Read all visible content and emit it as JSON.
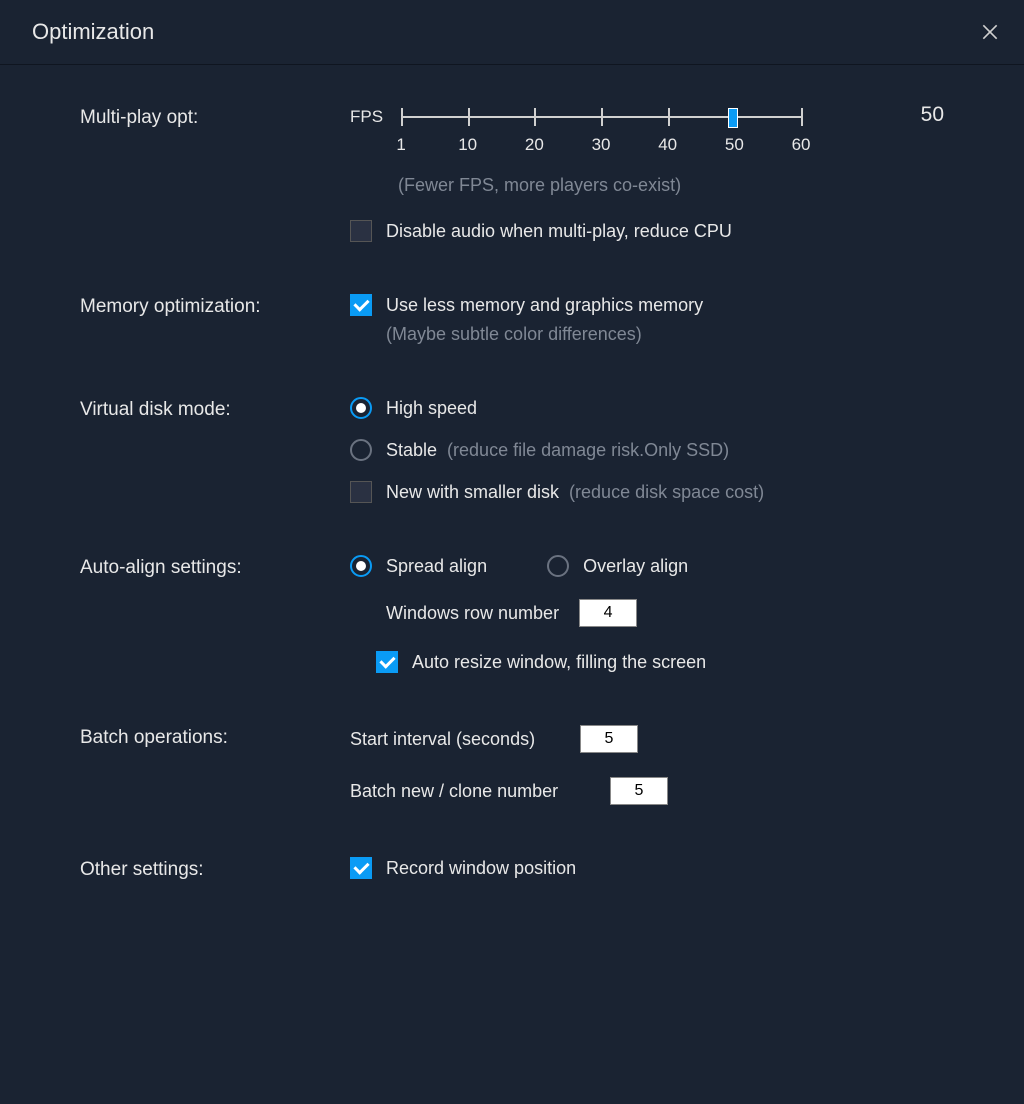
{
  "title": "Optimization",
  "multiPlay": {
    "label": "Multi-play opt:",
    "fpsLabel": "FPS",
    "min": 1,
    "max": 60,
    "value": 50,
    "ticks": [
      "1",
      "10",
      "20",
      "30",
      "40",
      "50",
      "60"
    ],
    "hint": "(Fewer FPS, more players co-exist)",
    "disableAudio": {
      "label": "Disable audio when multi-play, reduce CPU",
      "checked": false
    }
  },
  "memory": {
    "label": "Memory optimization:",
    "useLess": {
      "label": "Use less memory and graphics memory",
      "checked": true,
      "hint": "(Maybe subtle color differences)"
    }
  },
  "virtualDisk": {
    "label": "Virtual disk mode:",
    "highSpeed": {
      "label": "High speed",
      "selected": true
    },
    "stable": {
      "label": "Stable",
      "hint": "(reduce file damage risk.Only SSD)",
      "selected": false
    },
    "smaller": {
      "label": "New with smaller disk",
      "hint": "(reduce disk space cost)",
      "checked": false
    }
  },
  "autoAlign": {
    "label": "Auto-align settings:",
    "spread": {
      "label": "Spread align",
      "selected": true
    },
    "overlay": {
      "label": "Overlay align",
      "selected": false
    },
    "rowNumber": {
      "label": "Windows row number",
      "value": "4"
    },
    "autoResize": {
      "label": "Auto resize window, filling the screen",
      "checked": true
    }
  },
  "batch": {
    "label": "Batch operations:",
    "startInterval": {
      "label": "Start interval (seconds)",
      "value": "5"
    },
    "cloneNumber": {
      "label": "Batch new / clone number",
      "value": "5"
    }
  },
  "other": {
    "label": "Other settings:",
    "recordPosition": {
      "label": "Record window position",
      "checked": true
    }
  }
}
